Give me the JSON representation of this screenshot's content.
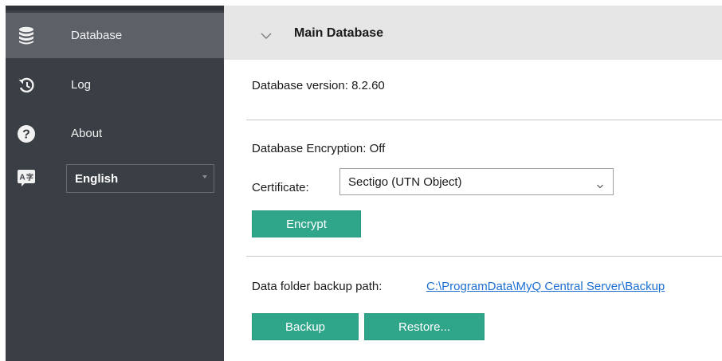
{
  "sidebar": {
    "items": [
      {
        "label": "Database",
        "icon": "database-icon",
        "active": true
      },
      {
        "label": "Log",
        "icon": "history-icon",
        "active": false
      },
      {
        "label": "About",
        "icon": "help-icon",
        "active": false
      }
    ],
    "language": {
      "icon": "translate-icon",
      "selected": "English"
    }
  },
  "header": {
    "title": "Main Database",
    "toggle_icon": "chevron-down-icon"
  },
  "main": {
    "version_text": "Database version: 8.2.60",
    "encryption_text": "Database Encryption: Off",
    "certificate_label": "Certificate:",
    "certificate_value": "Sectigo (UTN Object)",
    "encrypt_label": "Encrypt",
    "backup_path_label": "Data folder backup path:",
    "backup_path_link": "C:\\ProgramData\\MyQ Central Server\\Backup",
    "backup_label": "Backup",
    "restore_label": "Restore..."
  },
  "colors": {
    "sidebar_bg": "#3a3f45",
    "sidebar_active": "#5c6168",
    "header_bg": "#e6e6e6",
    "accent_button": "#2fa58a",
    "link": "#1c6fd1"
  }
}
